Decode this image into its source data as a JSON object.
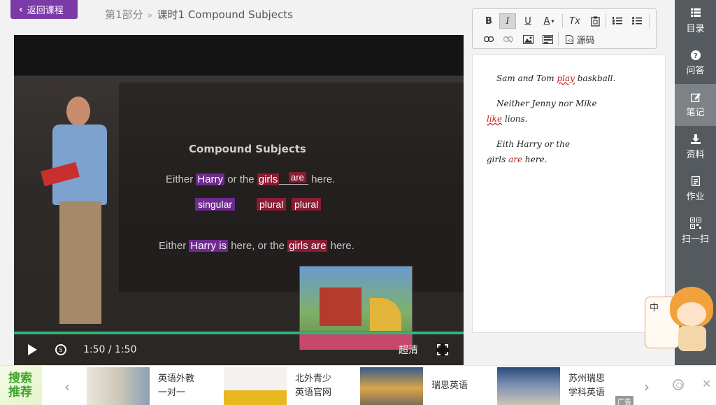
{
  "header": {
    "back_label": "返回课程",
    "breadcrumb": {
      "part": "第1部分",
      "sep": "»",
      "current": "课时1  Compound Subjects"
    }
  },
  "video": {
    "slide": {
      "title": "Compound Subjects",
      "line1": {
        "w1": "Either",
        "w2": "Harry",
        "w3": "or the",
        "w4": "girls",
        "blank": "_____",
        "w5": "here."
      },
      "above_tag": "are",
      "tags": [
        "singular",
        "plural",
        "plural"
      ],
      "line2": {
        "w1": "Either",
        "w2": "Harry is",
        "w3": "here, or the",
        "w4": "girls are",
        "w5": "here."
      }
    },
    "time": "1:50 / 1:50",
    "quality": "超清",
    "progress_percent": 100
  },
  "editor": {
    "toolbar": {
      "bold": "B",
      "italic": "I",
      "underline": "U",
      "fontcolor": "A",
      "clear": "Tx",
      "source": "源码"
    },
    "doc": {
      "p1_pre": "Sam and Tom",
      "p1_mark": "play",
      "p1_post": "baskball.",
      "p2_pre": "Neither Jenny nor Mike",
      "p2_mark": "like",
      "p2_post": "lions.",
      "p3_pre": "Eith Harry or the",
      "p3_line2_pre": "girls",
      "p3_red": "are",
      "p3_post": "here."
    }
  },
  "rail": {
    "items": [
      {
        "label": "目录",
        "icon": "list-icon"
      },
      {
        "label": "问答",
        "icon": "question-icon"
      },
      {
        "label": "笔记",
        "icon": "edit-icon"
      },
      {
        "label": "资料",
        "icon": "download-icon"
      },
      {
        "label": "作业",
        "icon": "homework-icon"
      },
      {
        "label": "扫一扫",
        "icon": "qrcode-icon"
      }
    ],
    "active_index": 2
  },
  "mascot": {
    "bubble": "中"
  },
  "adbar": {
    "label": "搜索推荐",
    "items": [
      {
        "line1": "英语外教",
        "line2": "一对一"
      },
      {
        "line1": "北外青少",
        "line2": "英语官网"
      },
      {
        "line1": "瑞思英语",
        "line2": ""
      },
      {
        "line1": "苏州瑞思",
        "line2": "学科英语"
      }
    ],
    "ad_tag": "广告"
  },
  "colors": {
    "brand_purple": "#7b3aa8",
    "progress_green": "#34b27a",
    "rail_bg": "#555a5e",
    "accent_red": "#c61b1b"
  }
}
